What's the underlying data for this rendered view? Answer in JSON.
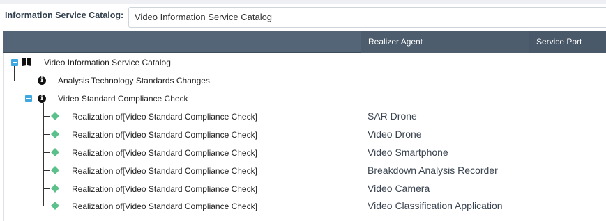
{
  "toolbar": {
    "catalog_label": "Information Service Catalog:",
    "catalog_value": "Video Information Service Catalog"
  },
  "grid": {
    "columns": [
      "",
      "Realizer Agent",
      "Service Port"
    ]
  },
  "tree": {
    "root": {
      "label": "Video Information Service Catalog",
      "expanded": true
    },
    "items": [
      {
        "label": "Analysis Technology Standards Changes",
        "icon": "info-icon"
      },
      {
        "label": "Video Standard Compliance Check",
        "icon": "info-icon",
        "expanded": true,
        "children": [
          {
            "label": "Realization of[Video Standard Compliance Check]",
            "agent": "SAR Drone"
          },
          {
            "label": "Realization of[Video Standard Compliance Check]",
            "agent": "Video Drone"
          },
          {
            "label": "Realization of[Video Standard Compliance Check]",
            "agent": "Video Smartphone"
          },
          {
            "label": "Realization of[Video Standard Compliance Check]",
            "agent": "Breakdown Analysis Recorder"
          },
          {
            "label": "Realization of[Video Standard Compliance Check]",
            "agent": "Video Camera"
          },
          {
            "label": "Realization of[Video Standard Compliance Check]",
            "agent": "Video Classification Application"
          }
        ]
      }
    ]
  },
  "colors": {
    "header_bg": "#546577",
    "toggle": "#3fa8e0",
    "realization_icon": "#5cc08a"
  }
}
